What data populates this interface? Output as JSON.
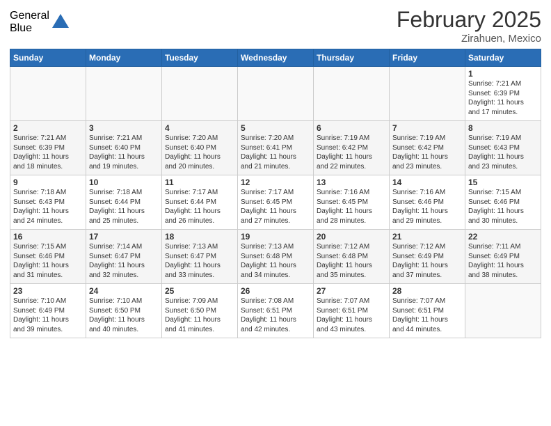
{
  "logo": {
    "general": "General",
    "blue": "Blue"
  },
  "calendar": {
    "title": "February 2025",
    "location": "Zirahuen, Mexico",
    "days": [
      "Sunday",
      "Monday",
      "Tuesday",
      "Wednesday",
      "Thursday",
      "Friday",
      "Saturday"
    ],
    "weeks": [
      [
        {
          "date": "",
          "info": ""
        },
        {
          "date": "",
          "info": ""
        },
        {
          "date": "",
          "info": ""
        },
        {
          "date": "",
          "info": ""
        },
        {
          "date": "",
          "info": ""
        },
        {
          "date": "",
          "info": ""
        },
        {
          "date": "1",
          "info": "Sunrise: 7:21 AM\nSunset: 6:39 PM\nDaylight: 11 hours\nand 17 minutes."
        }
      ],
      [
        {
          "date": "2",
          "info": "Sunrise: 7:21 AM\nSunset: 6:39 PM\nDaylight: 11 hours\nand 18 minutes."
        },
        {
          "date": "3",
          "info": "Sunrise: 7:21 AM\nSunset: 6:40 PM\nDaylight: 11 hours\nand 19 minutes."
        },
        {
          "date": "4",
          "info": "Sunrise: 7:20 AM\nSunset: 6:40 PM\nDaylight: 11 hours\nand 20 minutes."
        },
        {
          "date": "5",
          "info": "Sunrise: 7:20 AM\nSunset: 6:41 PM\nDaylight: 11 hours\nand 21 minutes."
        },
        {
          "date": "6",
          "info": "Sunrise: 7:19 AM\nSunset: 6:42 PM\nDaylight: 11 hours\nand 22 minutes."
        },
        {
          "date": "7",
          "info": "Sunrise: 7:19 AM\nSunset: 6:42 PM\nDaylight: 11 hours\nand 23 minutes."
        },
        {
          "date": "8",
          "info": "Sunrise: 7:19 AM\nSunset: 6:43 PM\nDaylight: 11 hours\nand 23 minutes."
        }
      ],
      [
        {
          "date": "9",
          "info": "Sunrise: 7:18 AM\nSunset: 6:43 PM\nDaylight: 11 hours\nand 24 minutes."
        },
        {
          "date": "10",
          "info": "Sunrise: 7:18 AM\nSunset: 6:44 PM\nDaylight: 11 hours\nand 25 minutes."
        },
        {
          "date": "11",
          "info": "Sunrise: 7:17 AM\nSunset: 6:44 PM\nDaylight: 11 hours\nand 26 minutes."
        },
        {
          "date": "12",
          "info": "Sunrise: 7:17 AM\nSunset: 6:45 PM\nDaylight: 11 hours\nand 27 minutes."
        },
        {
          "date": "13",
          "info": "Sunrise: 7:16 AM\nSunset: 6:45 PM\nDaylight: 11 hours\nand 28 minutes."
        },
        {
          "date": "14",
          "info": "Sunrise: 7:16 AM\nSunset: 6:46 PM\nDaylight: 11 hours\nand 29 minutes."
        },
        {
          "date": "15",
          "info": "Sunrise: 7:15 AM\nSunset: 6:46 PM\nDaylight: 11 hours\nand 30 minutes."
        }
      ],
      [
        {
          "date": "16",
          "info": "Sunrise: 7:15 AM\nSunset: 6:46 PM\nDaylight: 11 hours\nand 31 minutes."
        },
        {
          "date": "17",
          "info": "Sunrise: 7:14 AM\nSunset: 6:47 PM\nDaylight: 11 hours\nand 32 minutes."
        },
        {
          "date": "18",
          "info": "Sunrise: 7:13 AM\nSunset: 6:47 PM\nDaylight: 11 hours\nand 33 minutes."
        },
        {
          "date": "19",
          "info": "Sunrise: 7:13 AM\nSunset: 6:48 PM\nDaylight: 11 hours\nand 34 minutes."
        },
        {
          "date": "20",
          "info": "Sunrise: 7:12 AM\nSunset: 6:48 PM\nDaylight: 11 hours\nand 35 minutes."
        },
        {
          "date": "21",
          "info": "Sunrise: 7:12 AM\nSunset: 6:49 PM\nDaylight: 11 hours\nand 37 minutes."
        },
        {
          "date": "22",
          "info": "Sunrise: 7:11 AM\nSunset: 6:49 PM\nDaylight: 11 hours\nand 38 minutes."
        }
      ],
      [
        {
          "date": "23",
          "info": "Sunrise: 7:10 AM\nSunset: 6:49 PM\nDaylight: 11 hours\nand 39 minutes."
        },
        {
          "date": "24",
          "info": "Sunrise: 7:10 AM\nSunset: 6:50 PM\nDaylight: 11 hours\nand 40 minutes."
        },
        {
          "date": "25",
          "info": "Sunrise: 7:09 AM\nSunset: 6:50 PM\nDaylight: 11 hours\nand 41 minutes."
        },
        {
          "date": "26",
          "info": "Sunrise: 7:08 AM\nSunset: 6:51 PM\nDaylight: 11 hours\nand 42 minutes."
        },
        {
          "date": "27",
          "info": "Sunrise: 7:07 AM\nSunset: 6:51 PM\nDaylight: 11 hours\nand 43 minutes."
        },
        {
          "date": "28",
          "info": "Sunrise: 7:07 AM\nSunset: 6:51 PM\nDaylight: 11 hours\nand 44 minutes."
        },
        {
          "date": "",
          "info": ""
        }
      ]
    ]
  }
}
